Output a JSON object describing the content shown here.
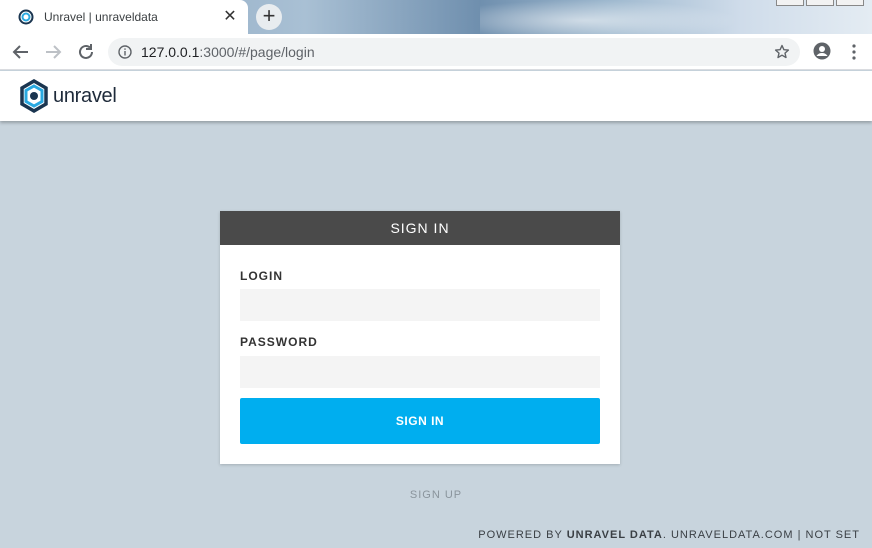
{
  "browser": {
    "tab": {
      "title": "Unravel | unraveldata",
      "close": "✕"
    },
    "new_tab": "+",
    "url": {
      "host": "127.0.0.1",
      "rest": ":3000/#/page/login"
    }
  },
  "header": {
    "logo_text": "unravel"
  },
  "login_card": {
    "title": "SIGN IN",
    "login_label": "LOGIN",
    "login_value": "",
    "password_label": "PASSWORD",
    "password_value": "",
    "submit_label": "SIGN IN"
  },
  "signup_link": "SIGN UP",
  "footer": {
    "powered_by": "POWERED BY ",
    "brand": "UNRAVEL DATA",
    "sep1": ". ",
    "site": "UNRAVELDATA.COM",
    "sep2": " | ",
    "version": "NOT SET"
  },
  "colors": {
    "page_bg": "#c8d4dd",
    "card_header": "#4a4a4a",
    "accent": "#00aeef"
  }
}
